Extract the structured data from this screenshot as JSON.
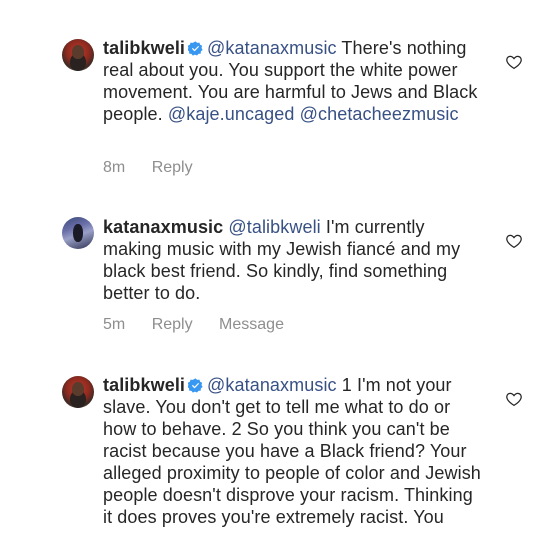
{
  "comments": [
    {
      "username": "talibkweli",
      "verified": true,
      "segments": [
        {
          "text": "@katanaxmusic",
          "type": "mention"
        },
        {
          "text": " There's nothing real about you. You support the white power movement. You are harmful to Jews and Black people. ",
          "type": "text"
        },
        {
          "text": "@kaje.uncaged",
          "type": "mention"
        },
        {
          "text": " ",
          "type": "text"
        },
        {
          "text": "@chetacheezmusic",
          "type": "mention"
        }
      ],
      "time": "8m",
      "reply_label": "Reply"
    },
    {
      "username": "katanaxmusic",
      "verified": false,
      "segments": [
        {
          "text": "@talibkweli",
          "type": "mention"
        },
        {
          "text": " I'm currently making music with my Jewish fiancé and my black best friend. So kindly, find something better to do.",
          "type": "text"
        }
      ],
      "time": "5m",
      "reply_label": "Reply",
      "message_label": "Message"
    },
    {
      "username": "talibkweli",
      "verified": true,
      "segments": [
        {
          "text": "@katanaxmusic",
          "type": "mention"
        },
        {
          "text": " 1 I'm not your slave. You don't get to tell me what to do or how to behave. 2 So you think you can't be racist because you have a Black friend? Your alleged proximity to people of color and Jewish people doesn't disprove your racism. Thinking it does proves you're extremely racist. You",
          "type": "text"
        }
      ]
    }
  ],
  "colors": {
    "mention": "#385185",
    "meta": "#8e8e8e",
    "verified": "#3897f0"
  },
  "icons": [
    "verified-badge-icon",
    "heart-icon"
  ]
}
